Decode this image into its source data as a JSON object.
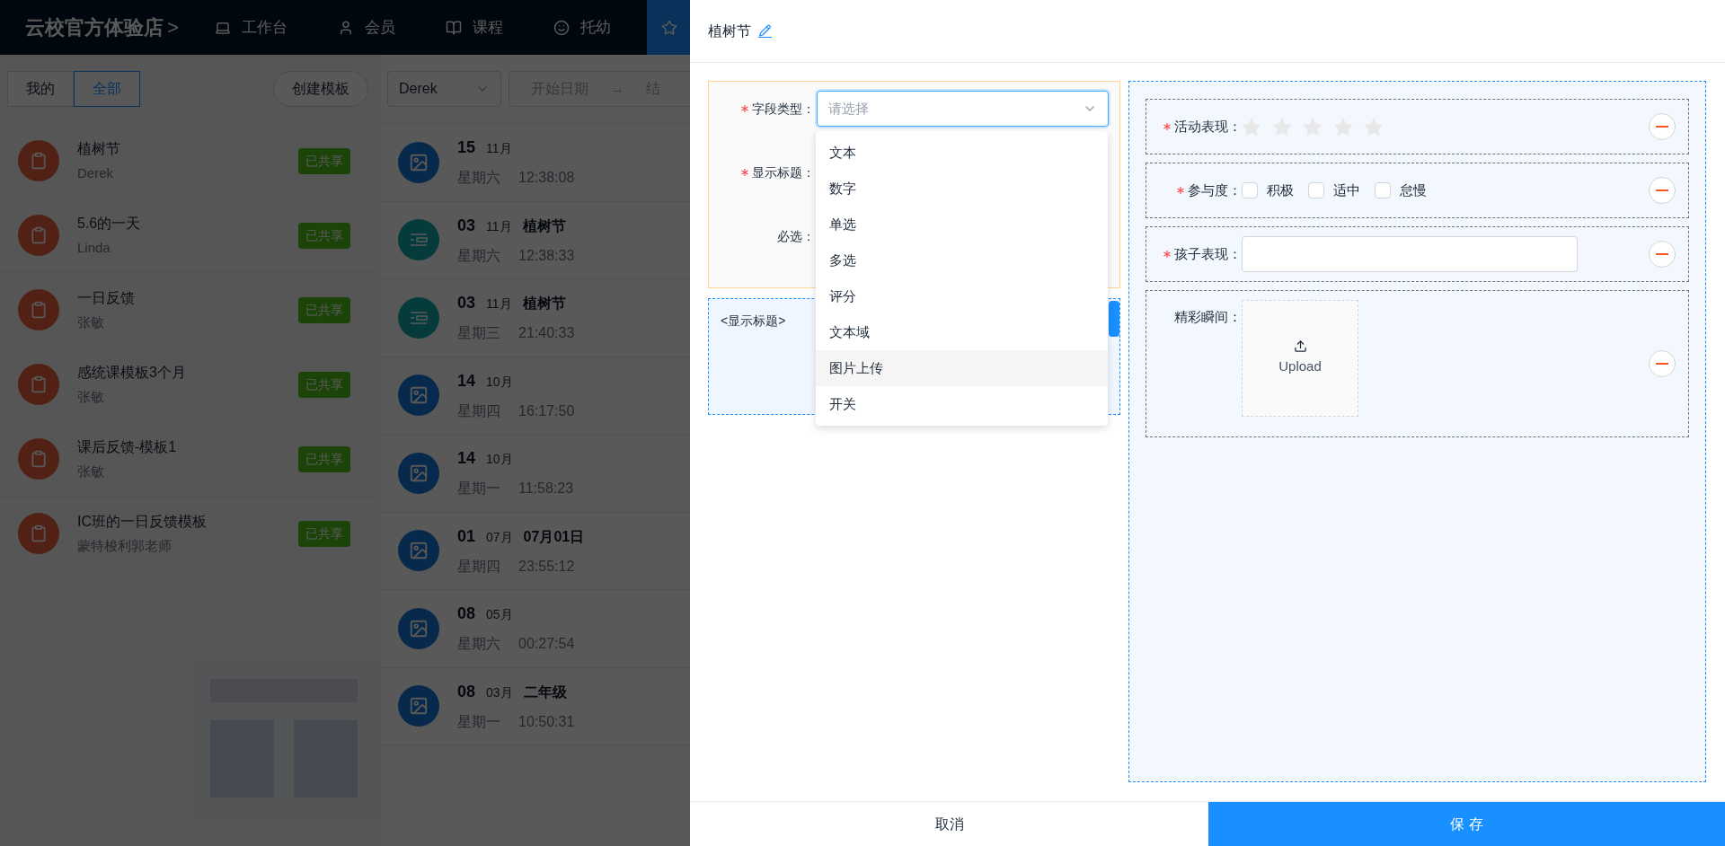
{
  "header": {
    "brand": "云校官方体验店",
    "brand_arrow": ">",
    "nav": [
      {
        "label": "工作台",
        "selected": false
      },
      {
        "label": "会员",
        "selected": false
      },
      {
        "label": "课程",
        "selected": false
      },
      {
        "label": "托幼",
        "selected": false
      },
      {
        "selected": true
      }
    ]
  },
  "template_panel": {
    "filters": [
      {
        "label": "我的",
        "selected": false
      },
      {
        "label": "全部",
        "selected": true
      }
    ],
    "create_button": "创建模板",
    "templates": [
      {
        "title": "植树节",
        "author": "Derek",
        "badge": "已共享"
      },
      {
        "title": "5.6的一天",
        "author": "Linda",
        "badge": "已共享"
      },
      {
        "title": "一日反馈",
        "author": "张敏",
        "badge": "已共享"
      },
      {
        "title": "感统课模板3个月",
        "author": "张敏",
        "badge": "已共享"
      },
      {
        "title": "课后反馈-模板1",
        "author": "张敏",
        "badge": "已共享"
      },
      {
        "title": "IC班的一日反馈模板",
        "author": "蒙特梭利郭老师",
        "badge": "已共享"
      }
    ]
  },
  "record_panel": {
    "user_select": "Derek",
    "date_range": {
      "start_placeholder": "开始日期",
      "separator": "→",
      "end_placeholder": "结"
    },
    "records": [
      {
        "kind": "image",
        "day": "15",
        "month": "11月",
        "weekday": "星期六",
        "time": "12:38:08"
      },
      {
        "kind": "form",
        "day": "03",
        "month": "11月",
        "title": "植树节",
        "weekday": "星期六",
        "time": "12:38:33"
      },
      {
        "kind": "form",
        "day": "03",
        "month": "11月",
        "title": "植树节",
        "weekday": "星期三",
        "time": "21:40:33"
      },
      {
        "kind": "image",
        "day": "14",
        "month": "10月",
        "weekday": "星期四",
        "time": "16:17:50"
      },
      {
        "kind": "image",
        "day": "14",
        "month": "10月",
        "weekday": "星期一",
        "time": "11:58:23"
      },
      {
        "kind": "image",
        "day": "01",
        "month": "07月",
        "title": "07月01日",
        "weekday": "星期四",
        "time": "23:55:12"
      },
      {
        "kind": "image",
        "day": "08",
        "month": "05月",
        "weekday": "星期六",
        "time": "00:27:54"
      },
      {
        "kind": "image",
        "day": "08",
        "month": "03月",
        "title": "二年级",
        "weekday": "星期一",
        "time": "10:50:31"
      }
    ]
  },
  "drawer": {
    "title": "植树节",
    "field_editor": {
      "fields": [
        {
          "label": "字段类型：",
          "required": true
        },
        {
          "label": "显示标题：",
          "required": true
        },
        {
          "label": "必选：",
          "required": false
        }
      ],
      "type_select": {
        "placeholder": "请选择",
        "open": true,
        "options": [
          {
            "label": "文本",
            "selected": false
          },
          {
            "label": "数字",
            "selected": false
          },
          {
            "label": "单选",
            "selected": false
          },
          {
            "label": "多选",
            "selected": false
          },
          {
            "label": "评分",
            "selected": false
          },
          {
            "label": "文本域",
            "selected": false
          },
          {
            "label": "图片上传",
            "selected": true
          },
          {
            "label": "开关",
            "selected": false
          }
        ]
      },
      "preview_title": "<显示标题>"
    },
    "form_preview": [
      {
        "kind": "rating",
        "label": "活动表现：",
        "required": true,
        "stars": 0
      },
      {
        "kind": "checkbox",
        "label": "参与度：",
        "required": true,
        "options": [
          {
            "label": "积极",
            "checked": false
          },
          {
            "label": "适中",
            "checked": false
          },
          {
            "label": "怠慢",
            "checked": false
          }
        ]
      },
      {
        "kind": "text",
        "label": "孩子表现：",
        "required": true
      },
      {
        "kind": "upload",
        "label": "精彩瞬间：",
        "required": false,
        "upload_label": "Upload"
      }
    ],
    "cancel_button": "取消",
    "save_button": "保 存"
  }
}
